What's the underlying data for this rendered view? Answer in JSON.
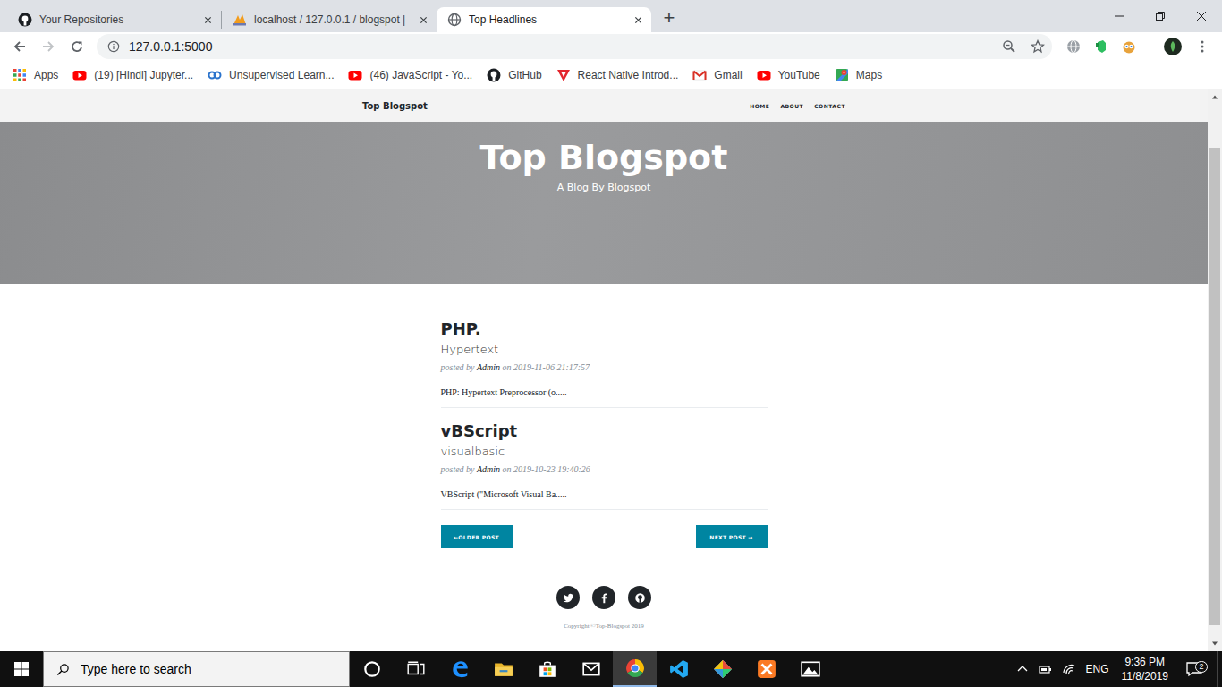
{
  "browser": {
    "tabs": [
      {
        "label": "Your Repositories",
        "kind": "github",
        "selected": false
      },
      {
        "label": "localhost / 127.0.0.1 / blogspot |",
        "kind": "pma",
        "selected": false
      },
      {
        "label": "Top Headlines",
        "kind": "globe",
        "selected": true
      }
    ],
    "new_tab": "+",
    "back_enabled": true,
    "forward_enabled": false,
    "address": "127.0.0.1:5000",
    "bookmarks": [
      {
        "label": "Apps",
        "kind": "apps"
      },
      {
        "label": "(19) [Hindi] Jupyter...",
        "kind": "youtube"
      },
      {
        "label": "Unsupervised Learn...",
        "kind": "coursera"
      },
      {
        "label": "(46) JavaScript - Yo...",
        "kind": "youtube"
      },
      {
        "label": "GitHub",
        "kind": "github"
      },
      {
        "label": "React Native Introd...",
        "kind": "tutorialspoint"
      },
      {
        "label": "Gmail",
        "kind": "gmail"
      },
      {
        "label": "YouTube",
        "kind": "youtube"
      },
      {
        "label": "Maps",
        "kind": "maps"
      }
    ],
    "scrollbar": {
      "offset": 0.08,
      "level": 0.9
    }
  },
  "page": {
    "brand": "Top Blogspot",
    "nav": [
      "HOME",
      "ABOUT",
      "CONTACT"
    ],
    "header": {
      "title": "Top Blogspot",
      "subtitle": "A Blog By Blogspot"
    },
    "posts": [
      {
        "title": "PHP.",
        "subtitle": "Hypertext",
        "meta_prefix": "posted by",
        "author": "Admin",
        "meta_on": "on",
        "date": "2019-11-06 21:17:57",
        "excerpt": "PHP: Hypertext Preprocessor (o....."
      },
      {
        "title": "vBScript",
        "subtitle": "visualbasic",
        "meta_prefix": "posted by",
        "author": "Admin",
        "meta_on": "on",
        "date": "2019-10-23 19:40:26",
        "excerpt": "VBScript (\"Microsoft Visual Ba....."
      }
    ],
    "pager": {
      "older": "←OLDER POST",
      "newer": "NEXT POST →"
    },
    "social": [
      {
        "kind": "twitter"
      },
      {
        "kind": "facebook"
      },
      {
        "kind": "github"
      }
    ],
    "copyright": "Copyright ©Top-Blogspot 2019"
  },
  "taskbar": {
    "search": "Type here to search",
    "apps": [
      {
        "kind": "cortana",
        "selected": false
      },
      {
        "kind": "task-view",
        "selected": false
      },
      {
        "kind": "edge",
        "selected": false
      },
      {
        "kind": "explorer",
        "selected": false
      },
      {
        "kind": "store",
        "selected": false
      },
      {
        "kind": "mail",
        "selected": false
      },
      {
        "kind": "chrome",
        "selected": true
      },
      {
        "kind": "vscode",
        "selected": false
      },
      {
        "kind": "git",
        "selected": false
      },
      {
        "kind": "xampp",
        "selected": false
      },
      {
        "kind": "photos",
        "selected": false
      }
    ],
    "language": "ENG",
    "time": "9:36 PM",
    "date": "11/8/2019",
    "notifications": "2"
  }
}
